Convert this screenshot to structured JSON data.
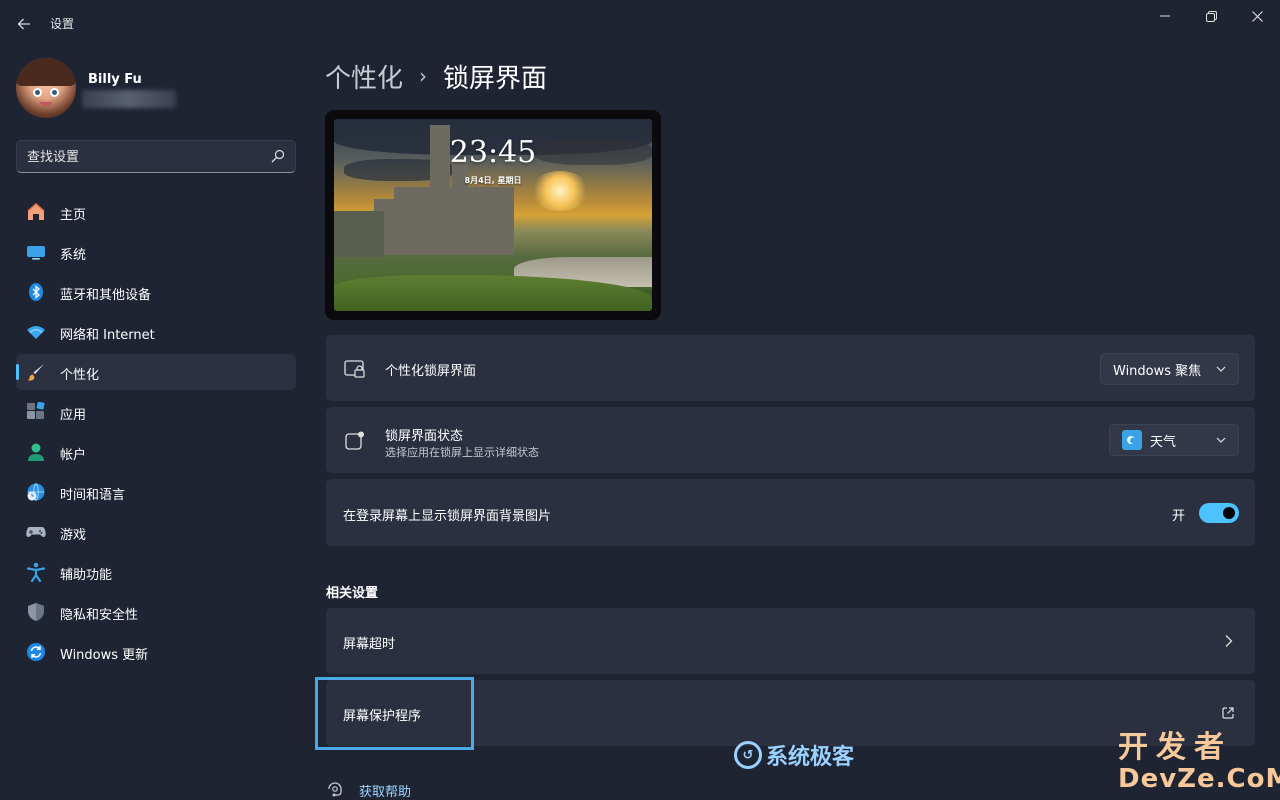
{
  "window": {
    "back_icon": "arrow-left-icon",
    "title": "设置",
    "controls": [
      "minimize-icon",
      "restore-icon",
      "close-icon"
    ]
  },
  "profile": {
    "name": "Billy Fu"
  },
  "search": {
    "placeholder": "查找设置",
    "icon": "search-icon"
  },
  "nav": {
    "active_index": 4,
    "accent": "#4cc2ff",
    "items": [
      {
        "label": "主页",
        "icon": "home-icon"
      },
      {
        "label": "系统",
        "icon": "display-icon"
      },
      {
        "label": "蓝牙和其他设备",
        "icon": "bluetooth-icon"
      },
      {
        "label": "网络和 Internet",
        "icon": "wifi-icon"
      },
      {
        "label": "个性化",
        "icon": "brush-icon"
      },
      {
        "label": "应用",
        "icon": "apps-icon"
      },
      {
        "label": "帐户",
        "icon": "account-icon"
      },
      {
        "label": "时间和语言",
        "icon": "globe-clock-icon"
      },
      {
        "label": "游戏",
        "icon": "gamepad-icon"
      },
      {
        "label": "辅助功能",
        "icon": "accessibility-icon"
      },
      {
        "label": "隐私和安全性",
        "icon": "shield-icon"
      },
      {
        "label": "Windows 更新",
        "icon": "refresh-icon"
      }
    ]
  },
  "breadcrumb": {
    "parent": "个性化",
    "separator": "›",
    "current": "锁屏界面"
  },
  "preview": {
    "time": "23:45",
    "date": "8月4日, 星期日"
  },
  "settings": {
    "personalize": {
      "label": "个性化锁屏界面",
      "value": "Windows 聚焦",
      "icon": "lock-screen-icon"
    },
    "status": {
      "label": "锁屏界面状态",
      "description": "选择应用在锁屏上显示详细状态",
      "value": "天气",
      "icon": "notification-dot-icon",
      "value_icon": "weather-icon"
    },
    "signin_background": {
      "label": "在登录屏幕上显示锁屏界面背景图片",
      "state_label": "开",
      "on": true
    }
  },
  "related": {
    "header": "相关设置",
    "screen_timeout": {
      "label": "屏幕超时",
      "icon": "chevron-right-icon"
    },
    "screensaver": {
      "label": "屏幕保护程序",
      "icon": "external-link-icon"
    }
  },
  "help": {
    "label": "获取帮助",
    "icon": "help-icon"
  },
  "watermarks": {
    "site1": "系统极客",
    "site2_top": "开发者",
    "site2_bottom": "DevZe.CoM"
  }
}
